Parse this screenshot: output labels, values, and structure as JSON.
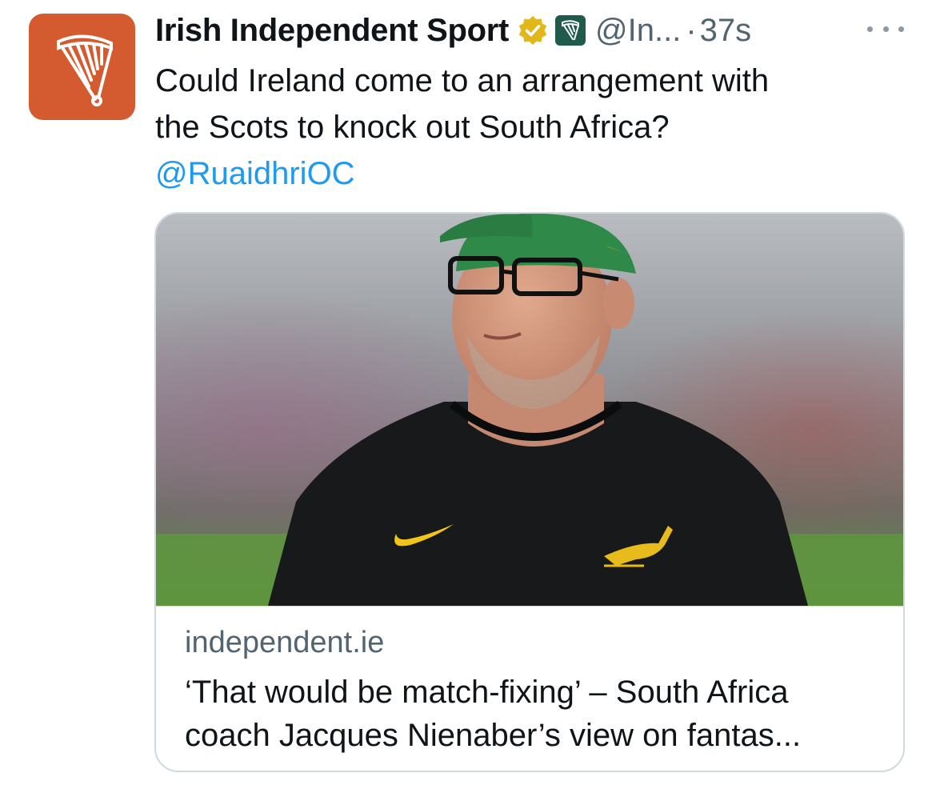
{
  "tweet": {
    "author": {
      "display_name": "Irish Independent Sport",
      "handle": "@In...",
      "verified_badge": "gold-verified-icon",
      "affiliation_badge": "harp-affiliation-icon"
    },
    "separator": "·",
    "timestamp": "37s",
    "more_icon": "more-options-icon",
    "text_lines": [
      "Could Ireland come to an arrangement with",
      "the Scots to knock out South Africa?"
    ],
    "mention": "@RuaidhriOC",
    "card": {
      "image": "photo-coach-in-green-cap-and-black-springboks-shirt",
      "domain": "independent.ie",
      "title_lines": [
        "‘That would be match-fixing’ – South Africa",
        "coach Jacques Nienaber’s view on fantas..."
      ]
    }
  },
  "colors": {
    "avatar_bg": "#d45a2f",
    "mention": "#1d9bf0",
    "secondary_text": "#536471",
    "verified_gold": "#e2b719",
    "affiliation_bg": "#1f5a4a"
  }
}
